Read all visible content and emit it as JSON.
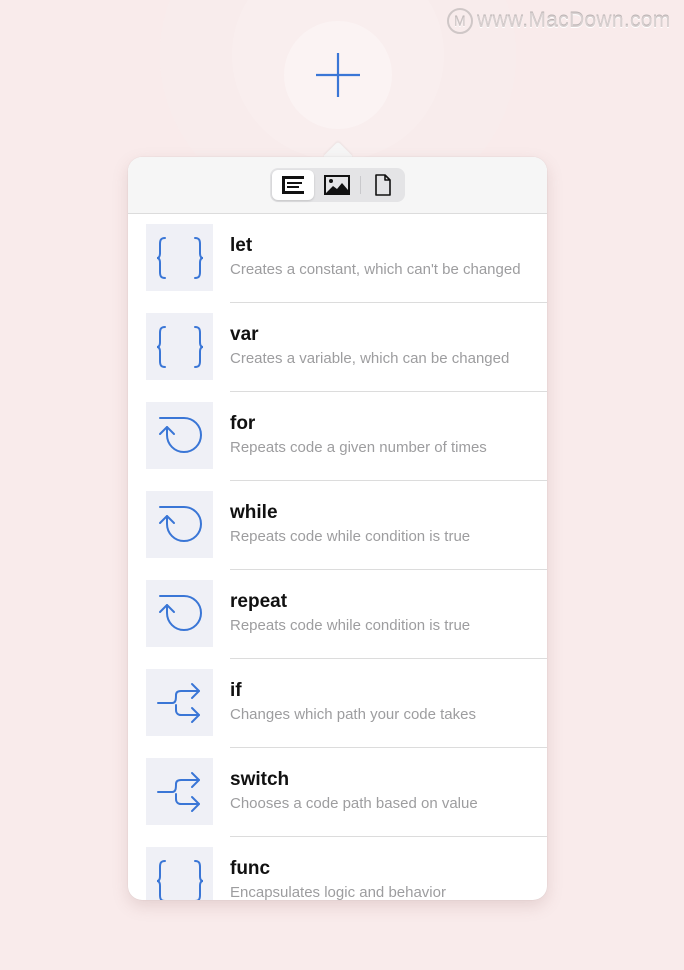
{
  "watermark": {
    "logo": "M",
    "text": "www.MacDown.com"
  },
  "add_button": {
    "icon": "plus-icon",
    "color": "#3a76d6"
  },
  "popover": {
    "tabs": [
      {
        "name": "code-snippets",
        "icon": "text-align-left-icon",
        "active": true
      },
      {
        "name": "media",
        "icon": "image-icon",
        "active": false
      },
      {
        "name": "files",
        "icon": "document-icon",
        "active": false
      }
    ],
    "items": [
      {
        "title": "let",
        "description": "Creates a constant, which can't be changed",
        "icon": "braces-icon"
      },
      {
        "title": "var",
        "description": "Creates a variable, which can be changed",
        "icon": "braces-icon"
      },
      {
        "title": "for",
        "description": "Repeats code a given number of times",
        "icon": "loop-icon"
      },
      {
        "title": "while",
        "description": "Repeats code while condition is true",
        "icon": "loop-icon"
      },
      {
        "title": "repeat",
        "description": "Repeats code while condition is true",
        "icon": "loop-icon"
      },
      {
        "title": "if",
        "description": "Changes which path your code takes",
        "icon": "branch-icon"
      },
      {
        "title": "switch",
        "description": "Chooses a code path based on value",
        "icon": "branch-icon"
      },
      {
        "title": "func",
        "description": "Encapsulates logic and behavior",
        "icon": "braces-icon"
      }
    ]
  },
  "colors": {
    "accent": "#3a76d6",
    "background": "#f9ebeb",
    "icon_tile": "#eff0f6"
  }
}
